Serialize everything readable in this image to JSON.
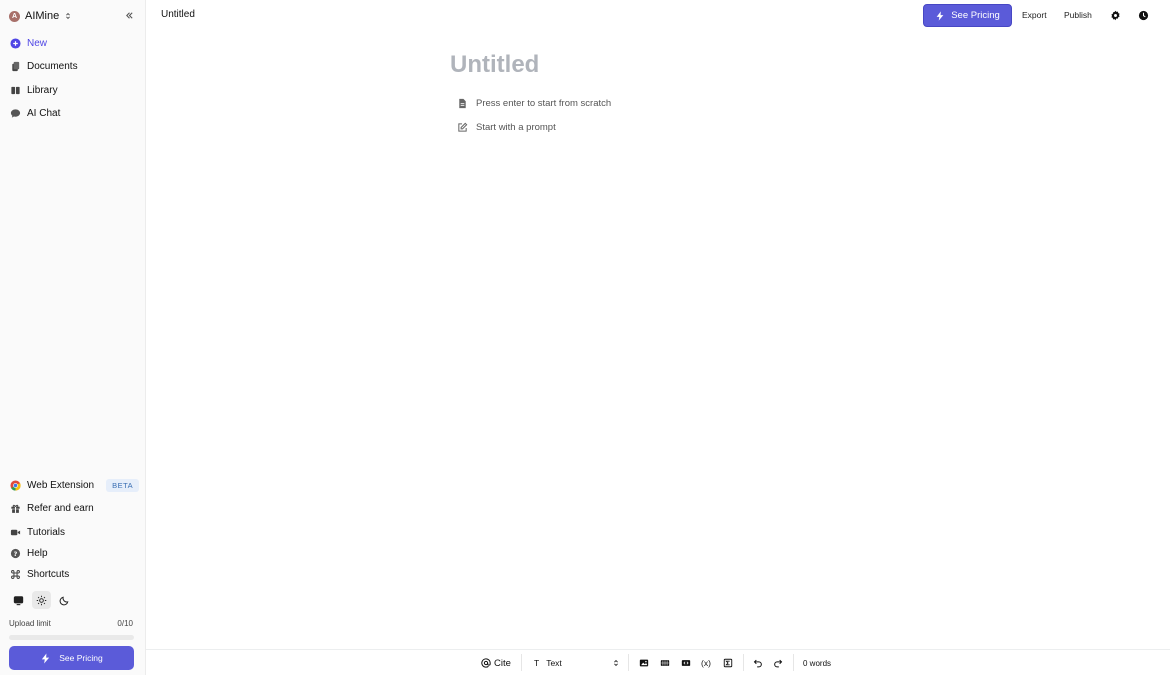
{
  "sidebar": {
    "workspace": {
      "initial": "A",
      "name": "AIMine"
    },
    "nav": [
      {
        "label": "New",
        "icon": "plus-circle-icon"
      },
      {
        "label": "Documents",
        "icon": "documents-icon"
      },
      {
        "label": "Library",
        "icon": "library-icon"
      },
      {
        "label": "AI Chat",
        "icon": "chat-icon"
      }
    ],
    "bottom": [
      {
        "label": "Web Extension",
        "badge": "BETA",
        "icon": "chrome-icon"
      },
      {
        "label": "Refer and earn",
        "icon": "gift-icon"
      },
      {
        "label": "Tutorials",
        "icon": "video-icon"
      },
      {
        "label": "Help",
        "icon": "help-icon"
      },
      {
        "label": "Shortcuts",
        "icon": "command-icon"
      }
    ],
    "theme_selected": "light",
    "upload": {
      "label": "Upload limit",
      "count": "0/10",
      "used_fraction": 0
    },
    "pricing_label": "See Pricing"
  },
  "header": {
    "doc_title": "Untitled",
    "pricing_label": "See Pricing",
    "export_label": "Export",
    "publish_label": "Publish"
  },
  "editor": {
    "title_placeholder": "Untitled",
    "hints": [
      "Press enter to start from scratch",
      "Start with a prompt"
    ]
  },
  "toolbar": {
    "cite_label": "Cite",
    "text_style_label": "Text",
    "word_count": "0 words"
  },
  "colors": {
    "accent": "#5b5bd9",
    "new_link": "#4f46e5",
    "title_placeholder": "#b0b4bb"
  }
}
